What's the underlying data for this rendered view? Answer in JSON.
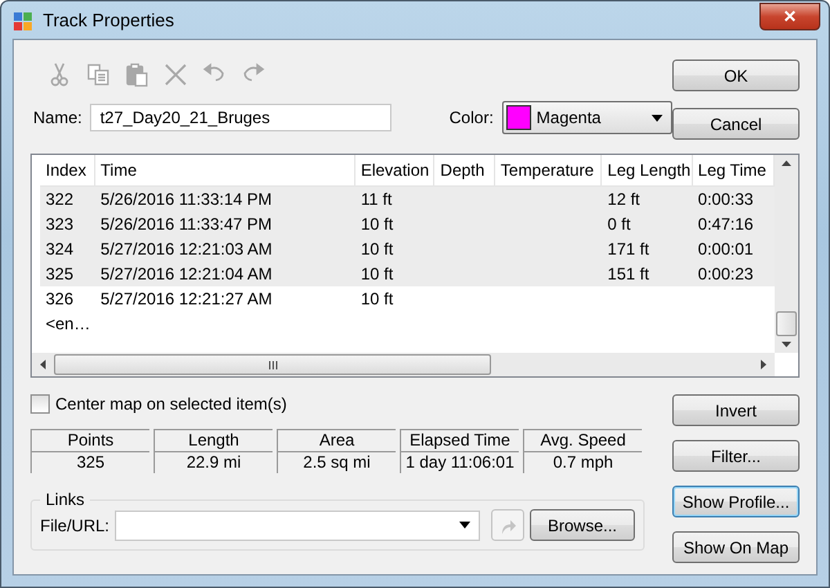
{
  "window": {
    "title": "Track Properties",
    "close": "✕"
  },
  "toolbar": [
    {
      "kind": "cut",
      "disabled": true
    },
    {
      "kind": "copy",
      "disabled": true
    },
    {
      "kind": "paste",
      "disabled": true
    },
    {
      "kind": "delete",
      "disabled": true
    },
    {
      "kind": "undo",
      "disabled": true
    },
    {
      "kind": "redo",
      "disabled": true
    }
  ],
  "name_field": {
    "label": "Name:",
    "value": "t27_Day20_21_Bruges"
  },
  "color_field": {
    "label": "Color:",
    "value": "Magenta",
    "color": "#ff00ff"
  },
  "side_buttons_top": [
    {
      "label": "OK",
      "focused": false
    },
    {
      "label": "Cancel",
      "focused": false
    }
  ],
  "table": {
    "columns": [
      "Index",
      "Time",
      "Elevation",
      "Depth",
      "Temperature",
      "Leg Length",
      "Leg Time"
    ],
    "rows": [
      {
        "cells": [
          "322",
          "5/26/2016 11:33:14 PM",
          "11 ft",
          "",
          "",
          "12 ft",
          "0:00:33"
        ],
        "selected": true
      },
      {
        "cells": [
          "323",
          "5/26/2016 11:33:47 PM",
          "10 ft",
          "",
          "",
          "0 ft",
          "0:47:16"
        ],
        "selected": true
      },
      {
        "cells": [
          "324",
          "5/27/2016 12:21:03 AM",
          "10 ft",
          "",
          "",
          "171 ft",
          "0:00:01"
        ],
        "selected": true
      },
      {
        "cells": [
          "325",
          "5/27/2016 12:21:04 AM",
          "10 ft",
          "",
          "",
          "151 ft",
          "0:00:23"
        ],
        "selected": true
      },
      {
        "cells": [
          "326",
          "5/27/2016 12:21:27 AM",
          "10 ft",
          "",
          "",
          "",
          ""
        ],
        "selected": false
      },
      {
        "cells": [
          "<en…",
          "",
          "",
          "",
          "",
          "",
          ""
        ],
        "selected": false
      }
    ]
  },
  "center_map": {
    "label": "Center map on selected item(s)",
    "checked": false
  },
  "stats": [
    {
      "label": "Points",
      "value": "325"
    },
    {
      "label": "Length",
      "value": "22.9 mi"
    },
    {
      "label": "Area",
      "value": "2.5 sq mi"
    },
    {
      "label": "Elapsed Time",
      "value": "1 day 11:06:01"
    },
    {
      "label": "Avg. Speed",
      "value": "0.7 mph"
    }
  ],
  "links": {
    "title": "Links",
    "label": "File/URL:",
    "browse": "Browse..."
  },
  "side_buttons_bottom": [
    {
      "label": "Invert",
      "focused": false
    },
    {
      "label": "Filter...",
      "focused": false
    },
    {
      "label": "Show Profile...",
      "focused": true
    },
    {
      "label": "Show On Map",
      "focused": false
    }
  ]
}
